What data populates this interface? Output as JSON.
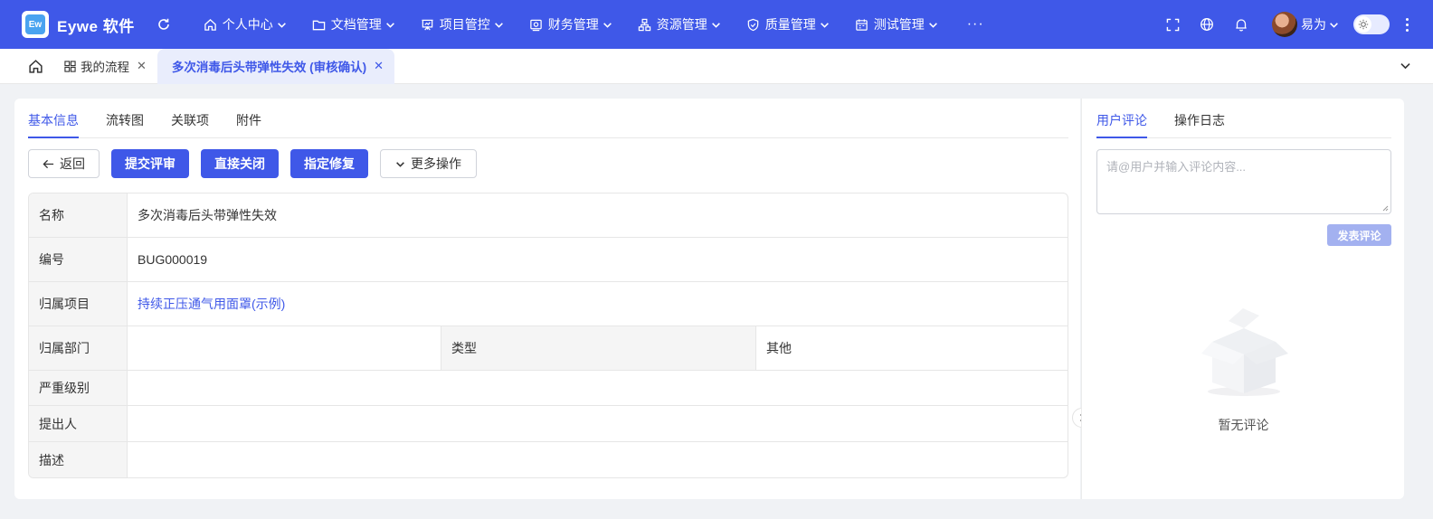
{
  "app": {
    "logo_mark": "Ew",
    "title": "Eywe 软件"
  },
  "nav": {
    "items": [
      {
        "label": "个人中心",
        "icon": "home-icon"
      },
      {
        "label": "文档管理",
        "icon": "folder-icon"
      },
      {
        "label": "项目管控",
        "icon": "presentation-icon"
      },
      {
        "label": "财务管理",
        "icon": "finance-icon"
      },
      {
        "label": "资源管理",
        "icon": "hierarchy-icon"
      },
      {
        "label": "质量管理",
        "icon": "shield-icon"
      },
      {
        "label": "测试管理",
        "icon": "calendar-icon"
      }
    ],
    "more": "···"
  },
  "user": {
    "name": "易为"
  },
  "tabs": {
    "items": [
      {
        "label": "我的流程"
      },
      {
        "label": "多次消毒后头带弹性失效 (审核确认)"
      }
    ]
  },
  "detail_tabs": [
    "基本信息",
    "流转图",
    "关联项",
    "附件"
  ],
  "actions": {
    "back": "返回",
    "submit_review": "提交评审",
    "close_direct": "直接关闭",
    "assign_fix": "指定修复",
    "more": "更多操作"
  },
  "fields": {
    "name_label": "名称",
    "name_value": "多次消毒后头带弹性失效",
    "code_label": "编号",
    "code_value": "BUG000019",
    "project_label": "归属项目",
    "project_value": "持续正压通气用面罩(示例)",
    "dept_label": "归属部门",
    "dept_value": "",
    "type_label": "类型",
    "type_value": "其他",
    "severity_label": "严重级别",
    "severity_value": "",
    "submitter_label": "提出人",
    "submitter_value": "",
    "desc_label": "描述",
    "desc_value": ""
  },
  "side": {
    "tabs": [
      "用户评论",
      "操作日志"
    ],
    "comment_placeholder": "请@用户并输入评论内容...",
    "post_button": "发表评论",
    "empty_text": "暂无评论"
  },
  "colors": {
    "primary": "#3f58e8",
    "post_disabled": "#a3b1f0"
  }
}
